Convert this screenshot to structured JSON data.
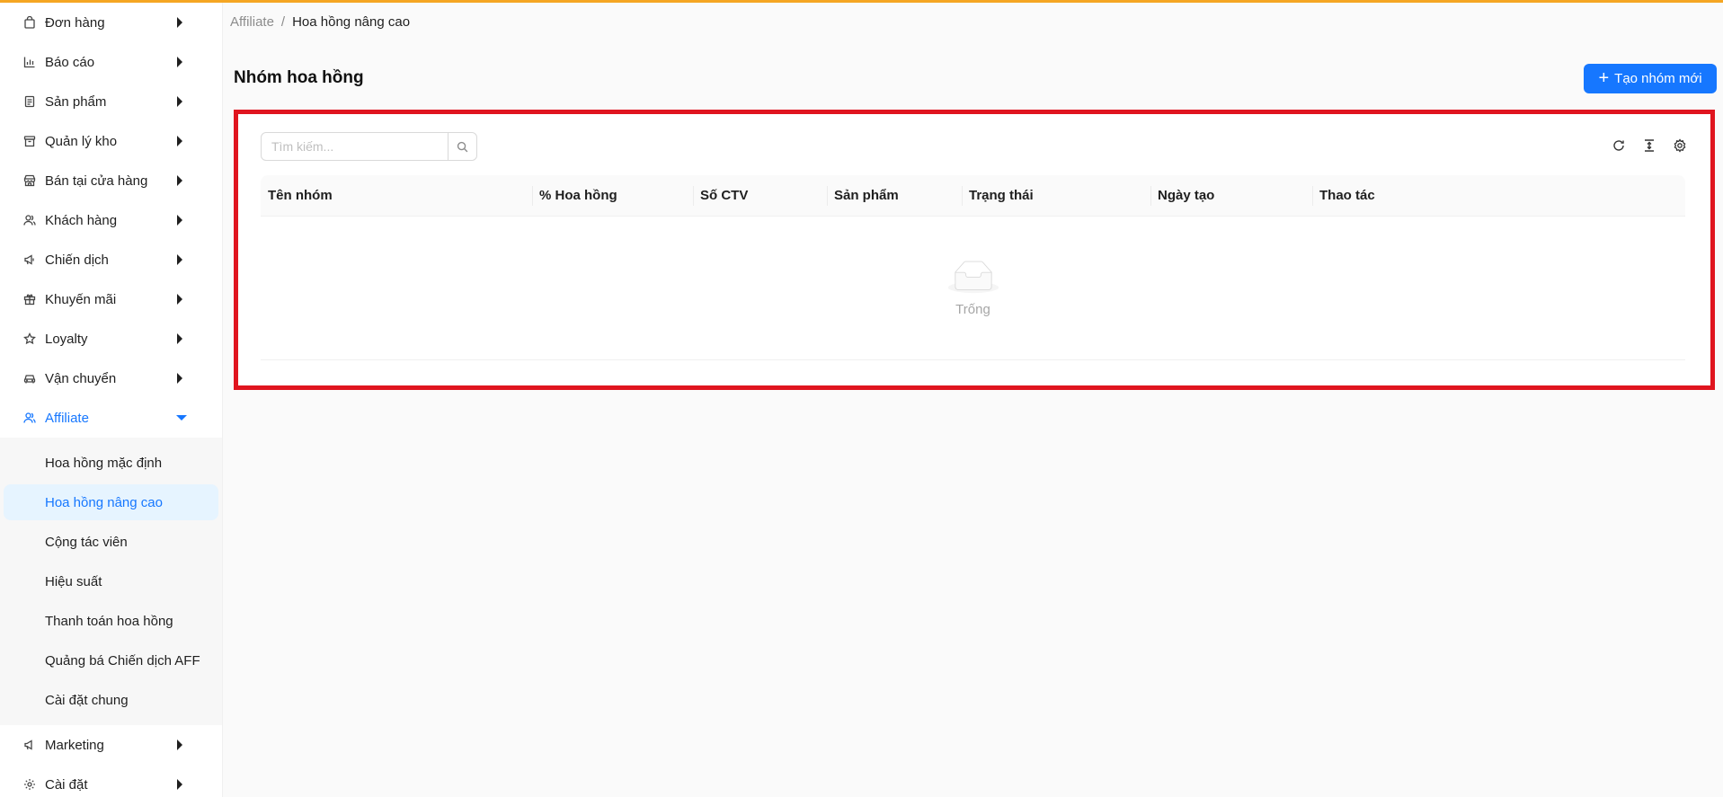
{
  "sidebar": {
    "items": [
      {
        "label": "Đơn hàng",
        "icon": "shopping-bag-icon"
      },
      {
        "label": "Báo cáo",
        "icon": "bar-chart-icon"
      },
      {
        "label": "Sản phẩm",
        "icon": "product-list-icon"
      },
      {
        "label": "Quản lý kho",
        "icon": "warehouse-box-icon"
      },
      {
        "label": "Bán tại cửa hàng",
        "icon": "shop-icon"
      },
      {
        "label": "Khách hàng",
        "icon": "users-icon"
      },
      {
        "label": "Chiến dịch",
        "icon": "megaphone-icon"
      },
      {
        "label": "Khuyến mãi",
        "icon": "gift-icon"
      },
      {
        "label": "Loyalty",
        "icon": "star-icon"
      },
      {
        "label": "Vận chuyển",
        "icon": "car-icon"
      },
      {
        "label": "Affiliate",
        "icon": "affiliate-icon"
      }
    ],
    "affiliate_sub": [
      {
        "label": "Hoa hồng mặc định"
      },
      {
        "label": "Hoa hồng nâng cao"
      },
      {
        "label": "Cộng tác viên"
      },
      {
        "label": "Hiệu suất"
      },
      {
        "label": "Thanh toán hoa hồng"
      },
      {
        "label": "Quảng bá Chiến dịch AFF"
      },
      {
        "label": "Cài đặt chung"
      }
    ],
    "bottom_items": [
      {
        "label": "Marketing",
        "icon": "notification-icon"
      },
      {
        "label": "Cài đặt",
        "icon": "gear-icon"
      }
    ]
  },
  "breadcrumb": {
    "parent": "Affiliate",
    "separator": "/",
    "current": "Hoa hồng nâng cao"
  },
  "page": {
    "title": "Nhóm hoa hồng",
    "create_label": "Tạo nhóm mới"
  },
  "search": {
    "placeholder": "Tìm kiếm..."
  },
  "table": {
    "columns": [
      "Tên nhóm",
      "% Hoa hồng",
      "Số CTV",
      "Sản phẩm",
      "Trạng thái",
      "Ngày tạo",
      "Thao tác"
    ],
    "empty_text": "Trống"
  },
  "colors": {
    "accent": "#1677ff",
    "highlight": "#e0151f",
    "topline": "#f5a623"
  }
}
